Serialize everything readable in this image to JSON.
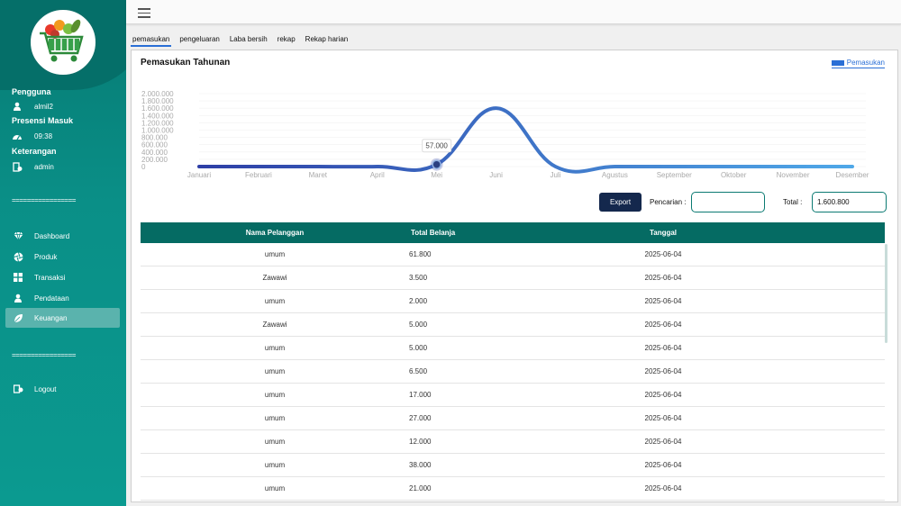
{
  "sidebar": {
    "user_section": "Pengguna",
    "user_name": "almil2",
    "presence_section": "Presensi Masuk",
    "presence_time": "09:38",
    "note_section": "Keterangan",
    "note_value": "admin",
    "separator": "=================",
    "nav": [
      {
        "label": "Dashboard",
        "icon": "diamond-icon"
      },
      {
        "label": "Produk",
        "icon": "aperture-icon"
      },
      {
        "label": "Transaksi",
        "icon": "grid-icon"
      },
      {
        "label": "Pendataan",
        "icon": "user-icon"
      },
      {
        "label": "Keuangan",
        "icon": "leaf-icon",
        "active": true
      }
    ],
    "logout": "Logout"
  },
  "tabs": [
    "pemasukan",
    "pengeluaran",
    "Laba bersih",
    "rekap",
    "Rekap harian"
  ],
  "chart_panel": {
    "title": "Pemasukan Tahunan",
    "legend": "Pemasukan",
    "tooltip_value": "57.000"
  },
  "chart_data": {
    "type": "line",
    "title": "Pemasukan Tahunan",
    "categories": [
      "Januari",
      "Februari",
      "Maret",
      "April",
      "Mei",
      "Juni",
      "Juli",
      "Agustus",
      "September",
      "Oktober",
      "November",
      "Desember"
    ],
    "yticks": [
      "2.000.000",
      "1.800.000",
      "1.600.000",
      "1.400.000",
      "1.200.000",
      "1.000.000",
      "800.000",
      "600.000",
      "400.000",
      "200.000",
      "0"
    ],
    "ylim": [
      0,
      2000000
    ],
    "series": [
      {
        "name": "Pemasukan",
        "values": [
          0,
          0,
          0,
          0,
          57000,
          1600800,
          0,
          0,
          0,
          0,
          0,
          0
        ]
      }
    ],
    "highlight_index": 4,
    "colors": {
      "line_start": "#2e3fa6",
      "line_end": "#4fa8e8"
    }
  },
  "controls": {
    "export_label": "Export",
    "search_label": "Pencarian :",
    "search_value": "",
    "total_label": "Total :",
    "total_value": "1.600.800"
  },
  "table": {
    "headers": [
      "Nama Pelanggan",
      "Total Belanja",
      "Tanggal"
    ],
    "rows": [
      [
        "umum",
        "61.800",
        "2025-06-04"
      ],
      [
        "Zawawi",
        "3.500",
        "2025-06-04"
      ],
      [
        "umum",
        "2.000",
        "2025-06-04"
      ],
      [
        "Zawawi",
        "5.000",
        "2025-06-04"
      ],
      [
        "umum",
        "5.000",
        "2025-06-04"
      ],
      [
        "umum",
        "6.500",
        "2025-06-04"
      ],
      [
        "umum",
        "17.000",
        "2025-06-04"
      ],
      [
        "umum",
        "27.000",
        "2025-06-04"
      ],
      [
        "umum",
        "12.000",
        "2025-06-04"
      ],
      [
        "umum",
        "38.000",
        "2025-06-04"
      ],
      [
        "umum",
        "21.000",
        "2025-06-04"
      ]
    ]
  },
  "colors": {
    "sidebar": "#0a8f87",
    "header": "#056b63",
    "accent": "#2a6fd6",
    "button": "#14284d"
  }
}
